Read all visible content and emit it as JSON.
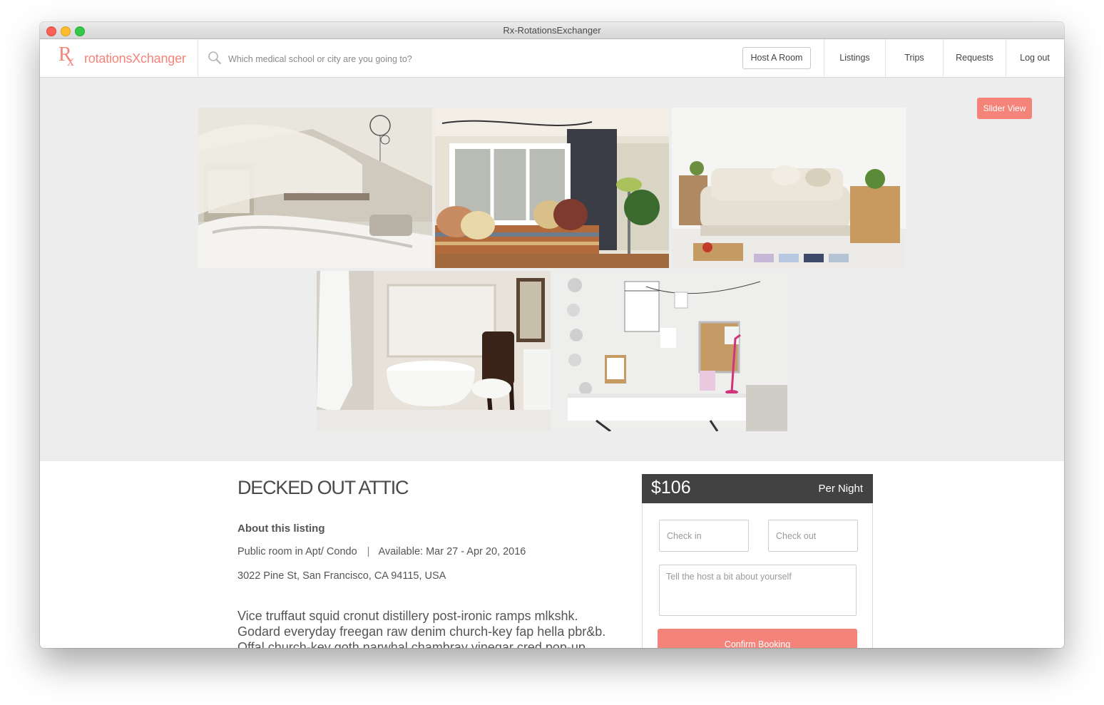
{
  "window": {
    "title": "Rx-RotationsExchanger"
  },
  "navbar": {
    "logo_text": "rotationsXchanger",
    "search_placeholder": "Which medical school or city are you going to?",
    "host_button": "Host A Room",
    "links": [
      "Listings",
      "Trips",
      "Requests",
      "Log out"
    ]
  },
  "gallery": {
    "slider_button": "Slider View"
  },
  "listing": {
    "title": "DECKED OUT ATTIC",
    "about_heading": "About this listing",
    "room_type": "Public room in Apt/ Condo",
    "separator": "|",
    "availability": "Available: Mar 27 - Apr 20, 2016",
    "address": "3022 Pine St, San Francisco, CA 94115, USA",
    "description": "Vice truffaut squid cronut distillery post-ironic ramps mlkshk. Godard everyday freegan raw denim church-key fap hella pbr&b. Offal church-key goth narwhal chambray vinegar cred pop-up"
  },
  "booking": {
    "price": "$106",
    "period": "Per Night",
    "checkin_placeholder": "Check in",
    "checkout_placeholder": "Check out",
    "message_placeholder": "Tell the host a bit about yourself",
    "confirm_button": "Confirm Booking"
  },
  "colors": {
    "accent": "#f4847a",
    "booking_header": "#424242",
    "gallery_background": "#ededed"
  }
}
